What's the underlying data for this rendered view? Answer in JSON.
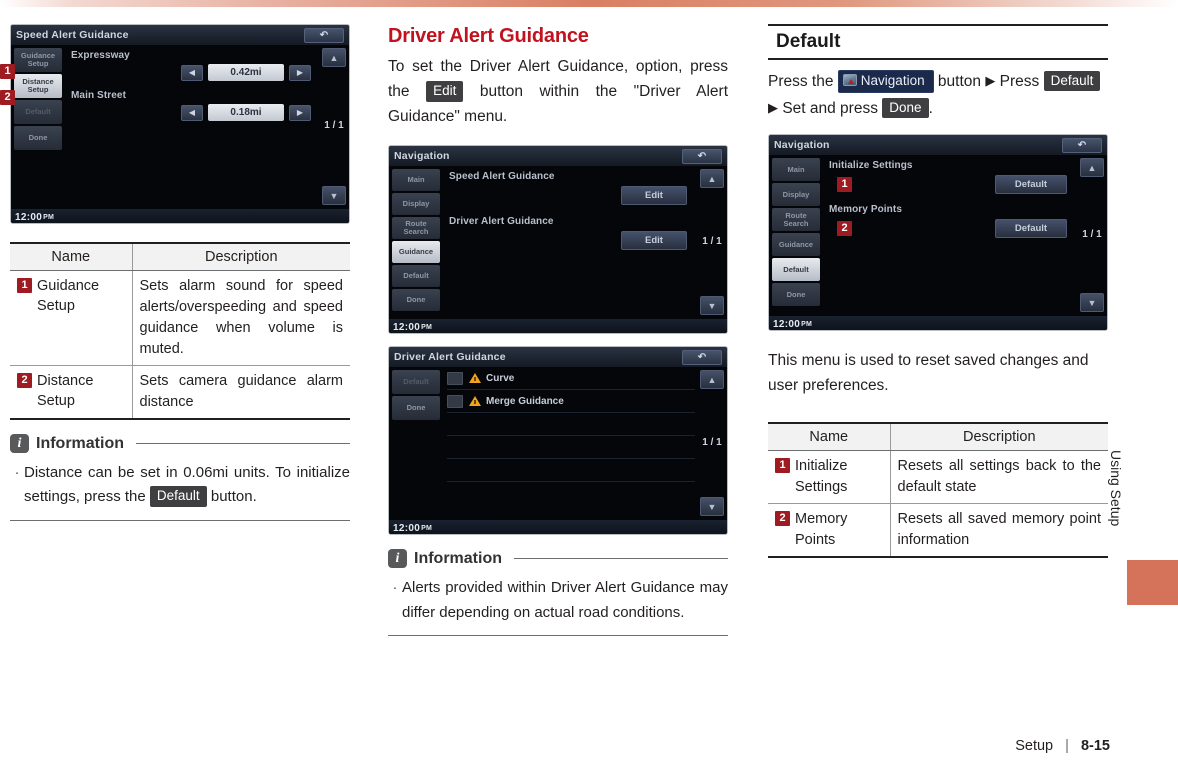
{
  "left_column": {
    "screenshot": {
      "title": "Speed Alert Guidance",
      "back_icon": "back-arrow-icon",
      "side_buttons": [
        {
          "label": "Guidance Setup",
          "state": "normal"
        },
        {
          "label": "Distance Setup",
          "state": "selected"
        },
        {
          "label": "Default",
          "state": "dim"
        },
        {
          "label": "Done",
          "state": "normal"
        }
      ],
      "rows": [
        {
          "label": "Expressway",
          "value": "0.42mi"
        },
        {
          "label": "Main Street",
          "value": "0.18mi"
        }
      ],
      "page_indicator": "1 / 1",
      "clock": "12:00",
      "clock_meridiem": "PM",
      "markers": [
        "1",
        "2"
      ]
    },
    "table": {
      "headers": [
        "Name",
        "Description"
      ],
      "rows": [
        {
          "marker": "1",
          "name": "Guidance Setup",
          "description": "Sets alarm sound for speed alerts/overspeeding and speed guidance when volume is muted."
        },
        {
          "marker": "2",
          "name": "Distance Setup",
          "description": "Sets camera guidance alarm distance"
        }
      ]
    },
    "information": {
      "badge": "i",
      "title": "Information",
      "bullets": [
        {
          "text_before": "Distance can be set in 0.06mi units. To initialize settings, press the",
          "pill": "Default",
          "text_after": "button."
        }
      ]
    }
  },
  "middle_column": {
    "heading": "Driver Alert Guidance",
    "intro": {
      "text_before": "To set the Driver Alert Guidance, option, press the",
      "pill": "Edit",
      "text_after": "button within the \"Driver Alert Guidance\" menu."
    },
    "screenshot_1": {
      "title": "Navigation",
      "back_icon": "back-arrow-icon",
      "side_buttons": [
        {
          "label": "Main",
          "state": "normal"
        },
        {
          "label": "Display",
          "state": "normal"
        },
        {
          "label": "Route Search",
          "state": "normal"
        },
        {
          "label": "Guidance",
          "state": "selected"
        },
        {
          "label": "Default",
          "state": "normal"
        },
        {
          "label": "Done",
          "state": "normal"
        }
      ],
      "rows": [
        {
          "label": "Speed Alert Guidance",
          "button": "Edit"
        },
        {
          "label": "Driver Alert Guidance",
          "button": "Edit"
        }
      ],
      "page_indicator": "1 / 1",
      "clock": "12:00",
      "clock_meridiem": "PM"
    },
    "screenshot_2": {
      "title": "Driver Alert Guidance",
      "back_icon": "back-arrow-icon",
      "side_buttons": [
        {
          "label": "Default",
          "state": "dim"
        },
        {
          "label": "Done",
          "state": "normal"
        }
      ],
      "list_items": [
        {
          "label": "Curve",
          "icon": "warning-triangle-icon",
          "checked": false
        },
        {
          "label": "Merge Guidance",
          "icon": "warning-triangle-icon",
          "checked": false
        }
      ],
      "page_indicator": "1 / 1",
      "clock": "12:00",
      "clock_meridiem": "PM"
    },
    "information": {
      "badge": "i",
      "title": "Information",
      "bullets": [
        {
          "text": "Alerts provided within Driver Alert Guidance may differ depending on actual road conditions."
        }
      ]
    }
  },
  "right_column": {
    "heading": "Default",
    "intro": {
      "part1": "Press the",
      "nav_button": "Navigation",
      "nav_icon": "navigation-map-icon",
      "part2": "button",
      "arrow1": "▶",
      "part3": "Press",
      "default_pill": "Default",
      "arrow2": "▶",
      "part4": "Set and press",
      "done_pill": "Done",
      "part5": "."
    },
    "screenshot": {
      "title": "Navigation",
      "back_icon": "back-arrow-icon",
      "side_buttons": [
        {
          "label": "Main",
          "state": "normal"
        },
        {
          "label": "Display",
          "state": "normal"
        },
        {
          "label": "Route Search",
          "state": "normal"
        },
        {
          "label": "Guidance",
          "state": "normal"
        },
        {
          "label": "Default",
          "state": "selected"
        },
        {
          "label": "Done",
          "state": "normal"
        }
      ],
      "rows": [
        {
          "label": "Initialize Settings",
          "button": "Default",
          "marker": "1"
        },
        {
          "label": "Memory Points",
          "button": "Default",
          "marker": "2"
        }
      ],
      "page_indicator": "1 / 1",
      "clock": "12:00",
      "clock_meridiem": "PM"
    },
    "description": "This menu is used to reset saved changes and user preferences.",
    "table": {
      "headers": [
        "Name",
        "Description"
      ],
      "rows": [
        {
          "marker": "1",
          "name": "Initialize Settings",
          "description": "Resets all settings back to the default state"
        },
        {
          "marker": "2",
          "name": "Memory Points",
          "description": "Resets all saved memory point information"
        }
      ]
    }
  },
  "edge": {
    "label": "Using Setup",
    "tab_color": "#d4735a"
  },
  "footer": {
    "section": "Setup",
    "separator": "|",
    "page": "8-15"
  },
  "colors": {
    "accent_red": "#c1121f",
    "marker_red": "#9e1b22",
    "edge_tab": "#d4735a",
    "pill_dark": "#3f3f41",
    "nav_pill": "#1b2a4a"
  }
}
